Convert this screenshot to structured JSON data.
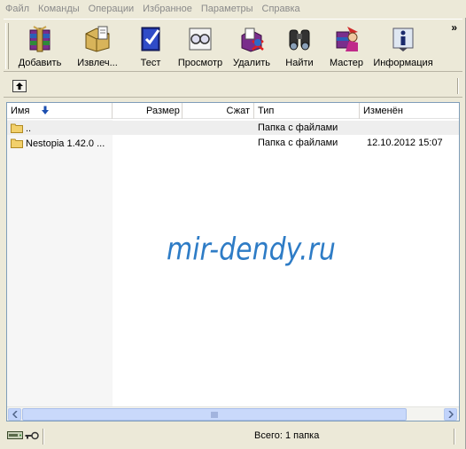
{
  "menu": [
    "Файл",
    "Команды",
    "Операции",
    "Избранное",
    "Параметры",
    "Справка"
  ],
  "toolbar": {
    "buttons": [
      {
        "label": "Добавить",
        "icon": "add-archive-icon"
      },
      {
        "label": "Извлеч...",
        "icon": "extract-icon"
      },
      {
        "label": "Тест",
        "icon": "test-icon"
      },
      {
        "label": "Просмотр",
        "icon": "view-icon"
      },
      {
        "label": "Удалить",
        "icon": "delete-icon"
      },
      {
        "label": "Найти",
        "icon": "find-icon"
      },
      {
        "label": "Мастер",
        "icon": "wizard-icon"
      },
      {
        "label": "Информация",
        "icon": "info-icon"
      }
    ],
    "overflow": "»"
  },
  "columns": {
    "name": "Имя",
    "size": "Размер",
    "packed": "Сжат",
    "type": "Тип",
    "modified": "Изменён"
  },
  "rows": [
    {
      "name": "..",
      "size": "",
      "packed": "",
      "type": "Папка с файлами",
      "modified": ""
    },
    {
      "name": "Nestopia 1.42.0 ...",
      "size": "",
      "packed": "",
      "type": "Папка с файлами",
      "modified": "12.10.2012 15:07"
    }
  ],
  "watermark": "mir-dendy.ru",
  "status": {
    "text": "Всего: 1 папка"
  },
  "colors": {
    "watermark": "#2e7cc6",
    "menu_disabled": "#8a8a8a"
  }
}
